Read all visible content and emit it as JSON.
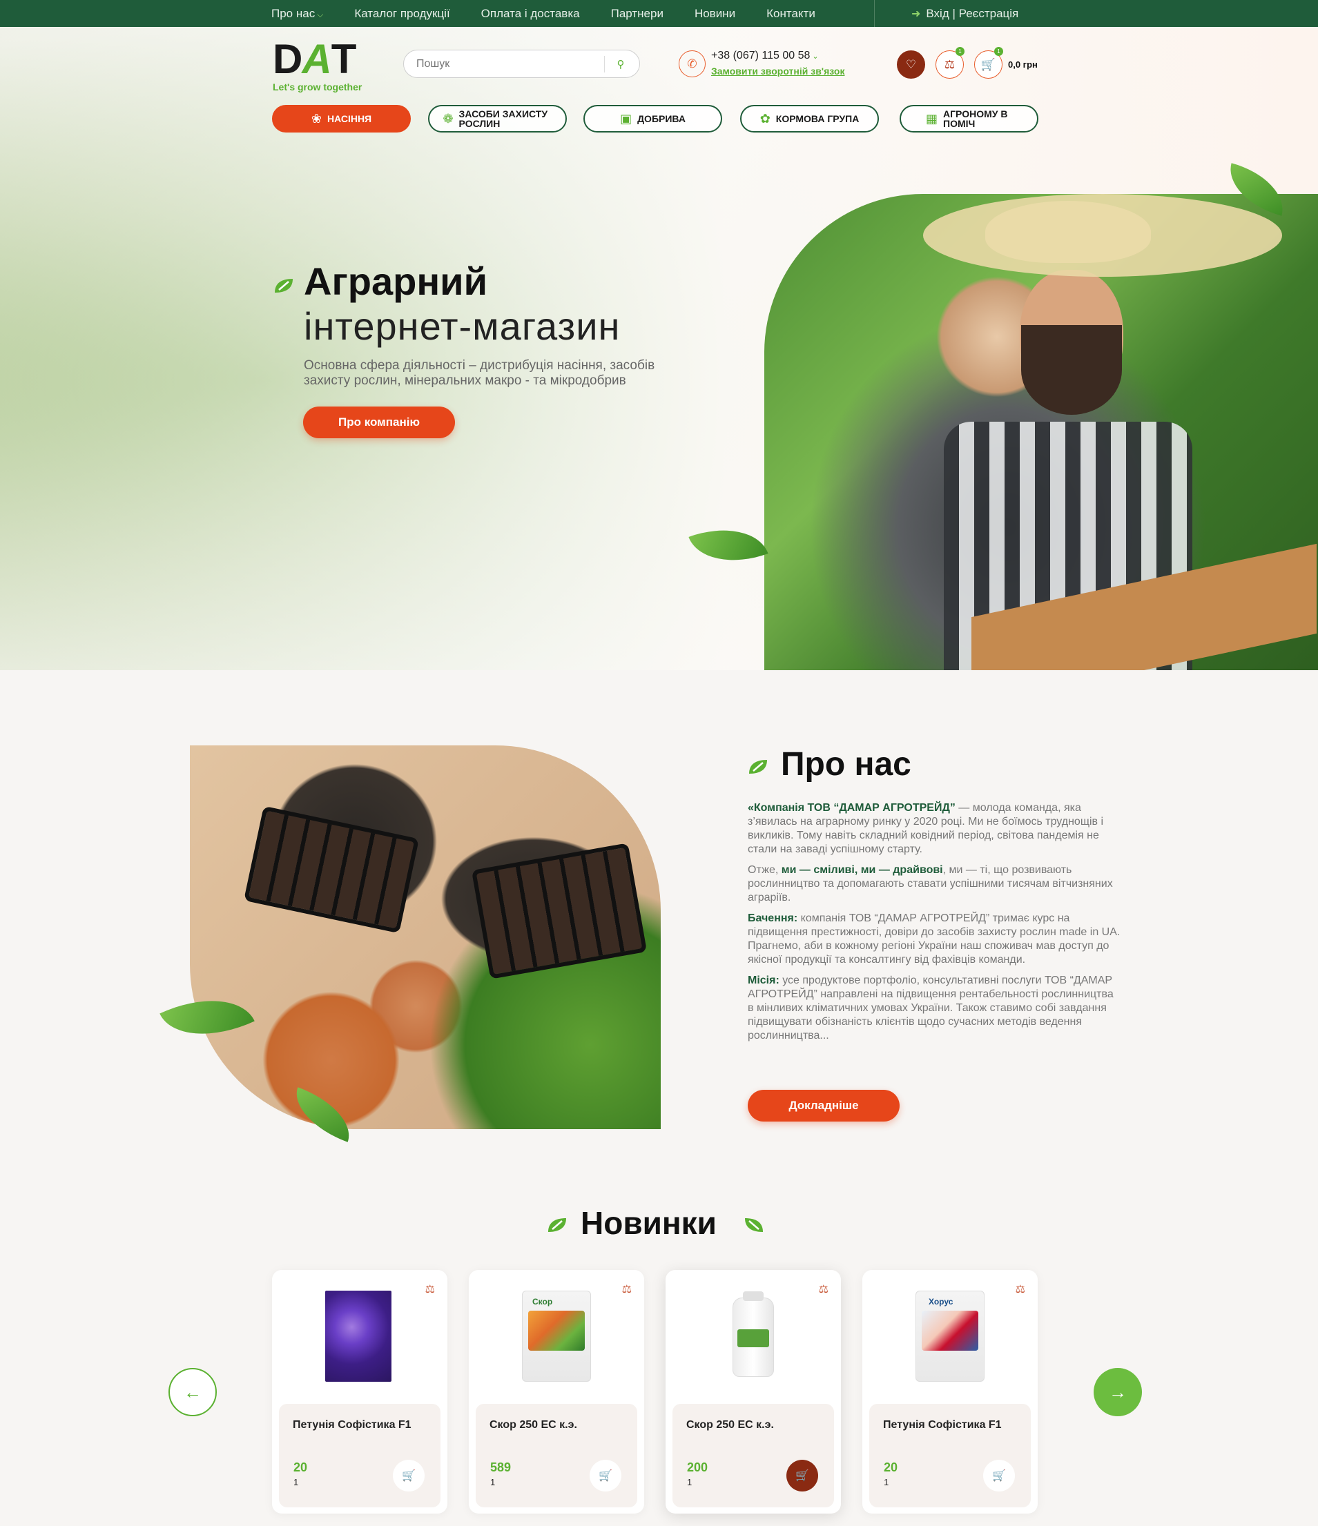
{
  "topbar": {
    "menu": [
      "Про нас",
      "Каталог продукції",
      "Оплата і доставка",
      "Партнери",
      "Новини",
      "Контакти"
    ],
    "login": "Вхід | Реєстрація"
  },
  "header": {
    "logo_text": "DAT",
    "logo_tagline": "Let's grow together",
    "search_placeholder": "Пошук",
    "phone": "+38 (067) 115 00 58",
    "callback": "Замовити зворотній зв'язок",
    "compare_count": "1",
    "cart_count": "1",
    "cart_total": "0,0 грн"
  },
  "categories": [
    {
      "label": "НАСІННЯ",
      "icon": "seed-icon",
      "active": true
    },
    {
      "label": "ЗАСОБИ ЗАХИСТУ РОСЛИН",
      "icon": "plant-protection-icon",
      "active": false
    },
    {
      "label": "ДОБРИВА",
      "icon": "fertilizer-icon",
      "active": false
    },
    {
      "label": "КОРМОВА ГРУПА",
      "icon": "feed-icon",
      "active": false
    },
    {
      "label": "АГРОНОМУ В ПОМІЧ",
      "icon": "agronomist-icon",
      "active": false
    }
  ],
  "hero": {
    "title_bold": "Аграрний",
    "title_light": "інтернет-магазин",
    "subtitle": "Основна сфера діяльності – дистрибуція насіння, засобів захисту рослин, мінеральних макро - та мікродобрив",
    "button": "Про компанію"
  },
  "about": {
    "title": "Про нас",
    "p1_bold": "«Компанія ТОВ “ДАМАР АГРОТРЕЙД”",
    "p1_text": " — молода команда, яка з’явилась на аграрному ринку у 2020 році. Ми не боїмось труднощів і викликів. Тому навіть складний ковідний період, світова пандемія не стали на заваді успішному старту.",
    "p2_start": "Отже, ",
    "p2_bold": "ми — сміливі, ми — драйвові",
    "p2_text": ", ми — ті, що розвивають рослинництво та допомагають ставати успішними тисячам вітчизняних аграріїв.",
    "p3_bold": "Бачення:",
    "p3_text": " компанія ТОВ “ДАМАР АГРОТРЕЙД” тримає курс на підвищення престижності, довіри до засобів захисту рослин made in UA. Прагнемо, аби в кожному регіоні України наш споживач мав доступ до якісної продукції та консалтингу від фахівців команди.",
    "p4_bold": "Місія:",
    "p4_text": " усе продуктове портфоліо, консультативні послуги ТОВ “ДАМАР АГРОТРЕЙД” направлені на підвищення рентабельності рослинництва в мінливих кліматичних умовах України. Також ставимо собі завдання підвищувати обізнаність клієнтів щодо сучасних методів ведення рослинництва...",
    "button": "Докладніше"
  },
  "news": {
    "title": "Новинки",
    "products": [
      {
        "name": "Петунія Софістика F1",
        "price": "20",
        "qty": "1",
        "image": "petunia"
      },
      {
        "name": "Скор 250 ЕС к.э.",
        "price": "589",
        "qty": "1",
        "image": "skor-pack",
        "pack_label": "Скор"
      },
      {
        "name": "Скор 250 ЕС к.э.",
        "price": "200",
        "qty": "1",
        "image": "bottle"
      },
      {
        "name": "Петунія Софістика F1",
        "price": "20",
        "qty": "1",
        "image": "horus-pack",
        "pack_label": "Хорус"
      }
    ]
  },
  "colors": {
    "brand_green": "#1f5c3a",
    "accent_green": "#5bb131",
    "accent_orange": "#e6461a",
    "dark_red": "#8a2a12"
  }
}
